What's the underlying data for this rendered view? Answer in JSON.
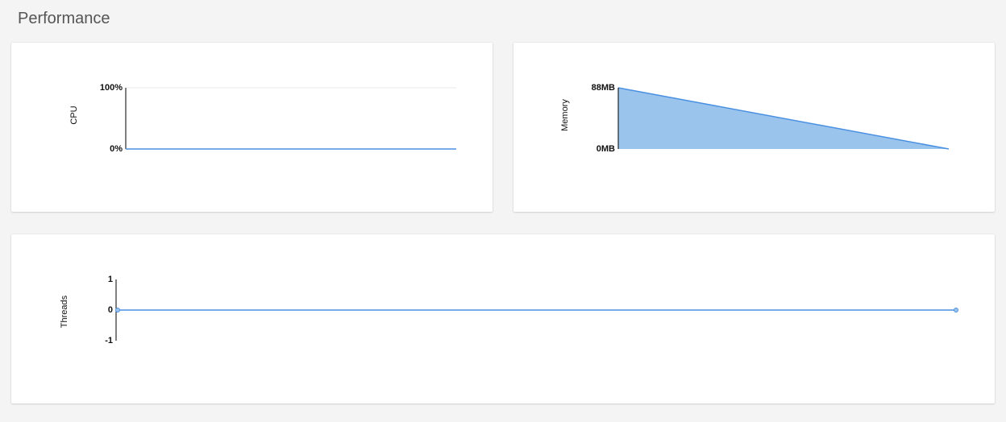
{
  "title": "Performance",
  "colors": {
    "line": "#4a90e2",
    "fill": "#9bc4ec",
    "grid": "#e0e0e0",
    "axis": "#000000"
  },
  "charts": {
    "cpu": {
      "axis_label": "CPU",
      "tick_top": "100%",
      "tick_bottom": "0%"
    },
    "memory": {
      "axis_label": "Memory",
      "tick_top": "88MB",
      "tick_bottom": "0MB"
    },
    "threads": {
      "axis_label": "Threads",
      "tick_top": "1",
      "tick_mid": "0",
      "tick_bottom": "-1"
    }
  },
  "chart_data": [
    {
      "type": "line",
      "id": "cpu",
      "title": "",
      "xlabel": "",
      "ylabel": "CPU",
      "ylim": [
        0,
        100
      ],
      "y_unit": "%",
      "x": [
        0,
        1
      ],
      "values": [
        0,
        0
      ]
    },
    {
      "type": "area",
      "id": "memory",
      "title": "",
      "xlabel": "",
      "ylabel": "Memory",
      "ylim": [
        0,
        88
      ],
      "y_unit": "MB",
      "x": [
        0,
        1
      ],
      "values": [
        88,
        0
      ]
    },
    {
      "type": "line",
      "id": "threads",
      "title": "",
      "xlabel": "",
      "ylabel": "Threads",
      "ylim": [
        -1,
        1
      ],
      "x": [
        0,
        1
      ],
      "values": [
        0,
        0
      ]
    }
  ]
}
